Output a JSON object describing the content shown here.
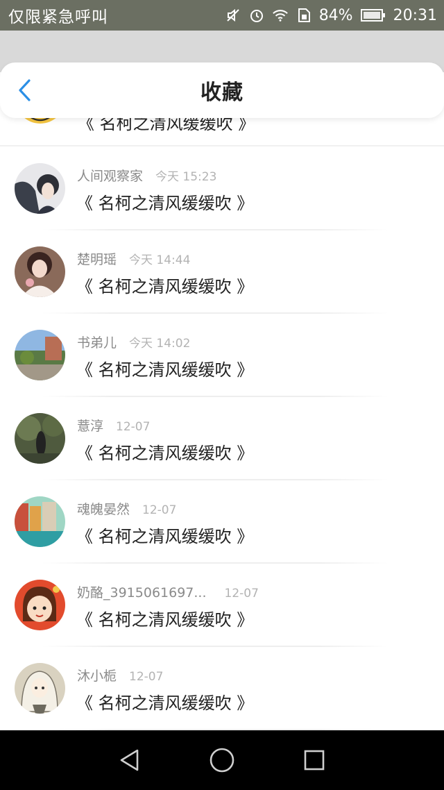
{
  "status_bar": {
    "carrier": "仅限紧急呼叫",
    "battery": "84%",
    "time": "20:31",
    "icons": [
      "mute-icon",
      "alarm-icon",
      "wifi-icon",
      "sim-icon",
      "battery-icon"
    ]
  },
  "header": {
    "title": "收藏",
    "back_icon": "chevron-left-icon",
    "accent_color": "#2b8fe6"
  },
  "partial_item": {
    "title": "《 名柯之清风缓缓吹 》"
  },
  "items": [
    {
      "name": "人间观察家",
      "time": "今天 15:23",
      "title": "《 名柯之清风缓缓吹 》"
    },
    {
      "name": "楚明瑶",
      "time": "今天 14:44",
      "title": "《 名柯之清风缓缓吹 》"
    },
    {
      "name": "书弟儿",
      "time": "今天 14:02",
      "title": "《 名柯之清风缓缓吹 》"
    },
    {
      "name": "薏淳",
      "time": "12-07",
      "title": "《 名柯之清风缓缓吹 》"
    },
    {
      "name": "魂魄晏然",
      "time": "12-07",
      "title": "《 名柯之清风缓缓吹 》"
    },
    {
      "name": "奶酪_3915061697...",
      "time": "12-07",
      "title": "《 名柯之清风缓缓吹 》"
    },
    {
      "name": "沐小栀",
      "time": "12-07",
      "title": "《 名柯之清风缓缓吹 》"
    }
  ],
  "nav": {
    "back": "triangle-back-icon",
    "home": "circle-home-icon",
    "recents": "square-recents-icon"
  }
}
